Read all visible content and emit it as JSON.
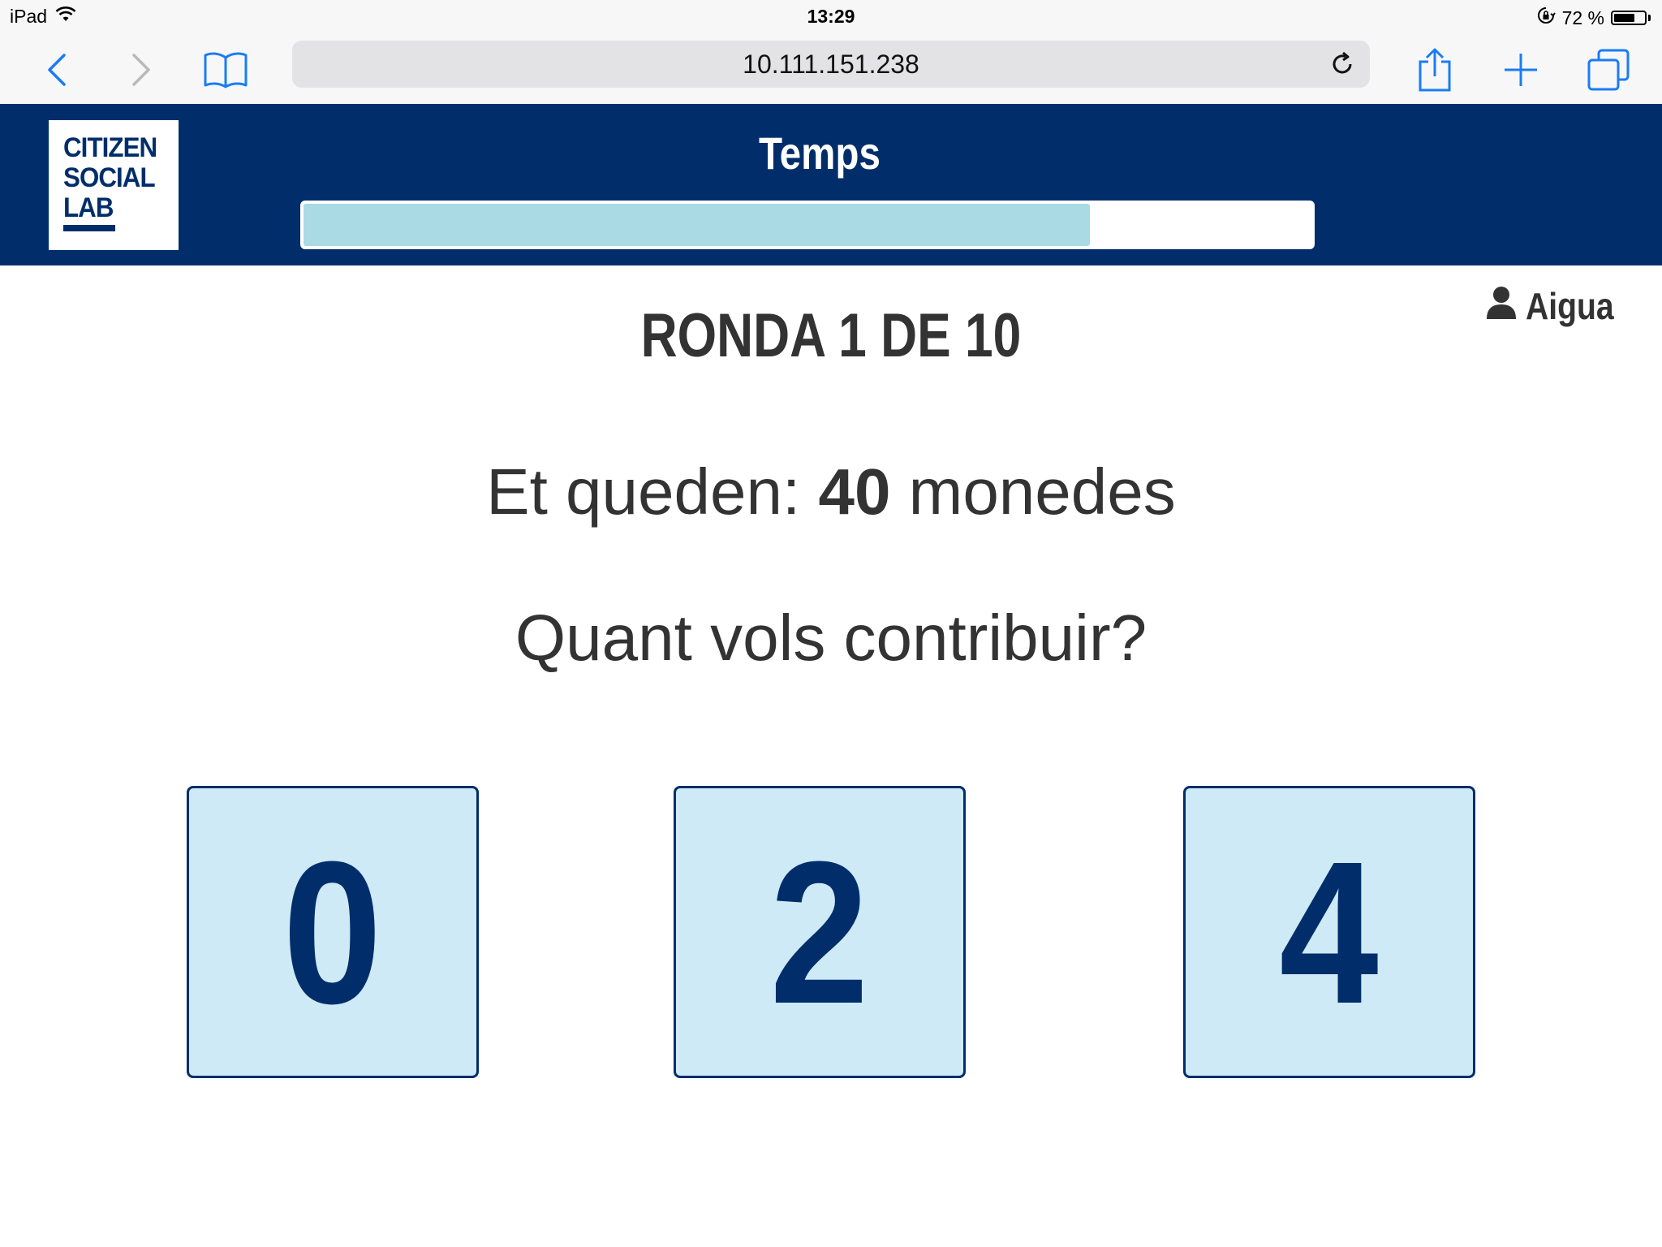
{
  "status_bar": {
    "device": "iPad",
    "time": "13:29",
    "battery_text": "72 %",
    "battery_level": 0.72
  },
  "browser": {
    "url": "10.111.151.238"
  },
  "header": {
    "logo_lines": [
      "CITIZEN",
      "SOCIAL",
      "LAB"
    ],
    "timer_title": "Temps",
    "timer_progress": 0.78
  },
  "main": {
    "user_name": "Aigua",
    "round_title": "RONDA 1 DE 10",
    "coins_prefix": "Et queden:",
    "coins_value": "40",
    "coins_suffix": "monedes",
    "question": "Quant vols contribuir?",
    "options": [
      "0",
      "2",
      "4"
    ]
  },
  "colors": {
    "brand_navy": "#012e6b",
    "timer_fill": "#aadae3",
    "option_bg": "#cdeaf6"
  }
}
